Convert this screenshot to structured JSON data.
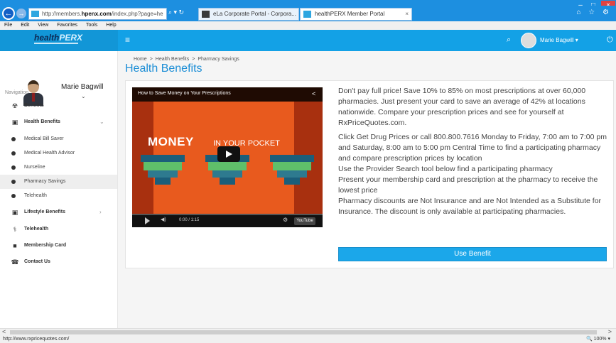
{
  "browser": {
    "url_prefix": "http://members.",
    "url_domain": "hpenx.com",
    "url_suffix": "/index.php?page=he",
    "addr_tools": "⌕ ▾ ↻",
    "tab1_label": "eLa Corporate Portal - Corpora...",
    "tab2_label": "healthPERX Member Portal",
    "tab_close": "×",
    "menu": [
      "File",
      "Edit",
      "View",
      "Favorites",
      "Tools",
      "Help"
    ],
    "status_url": "http://www.rxpricequotes.com/",
    "zoom": "🔍 100% ▾",
    "min_glyph": "–",
    "max_glyph": "□",
    "close_glyph": "×",
    "right_icons": "⌂ ☆ ⚙",
    "back_glyph": "←",
    "fwd_glyph": "→",
    "scroll_left": "<",
    "scroll_right": ">"
  },
  "header": {
    "logo_health": "health",
    "logo_perx": "PERX",
    "hamburger": "≡",
    "search_icon": "⌕",
    "user": "Marie Bagwill ▾",
    "power_icon": "⏻"
  },
  "sidebar": {
    "profile_name": "Marie Bagwill",
    "profile_caret": "⌄",
    "nav_label": "Navigation",
    "items": {
      "benefits": {
        "label": "Benefits",
        "icon": "☢"
      },
      "health_benefits": {
        "label": "Health Benefits",
        "icon": "▣",
        "chev": "⌄"
      },
      "lifestyle_benefits": {
        "label": "Lifestyle Benefits",
        "icon": "▣",
        "chev": "›"
      },
      "telehealth": {
        "label": "Telehealth",
        "icon": "⚕"
      },
      "membership_card": {
        "label": "Membership Card",
        "icon": "■"
      },
      "contact_us": {
        "label": "Contact Us",
        "icon": "☎"
      }
    },
    "sub_items": {
      "medical_bill_saver": "Medical Bill Saver",
      "medical_health_advisor": "Medical Health Advisor",
      "nurseline": "Nurseline",
      "pharmacy_savings": "Pharmacy Savings",
      "telehealth": "Telehealth"
    }
  },
  "main": {
    "breadcrumb": {
      "home": "Home",
      "section": "Health Benefits",
      "page": "Pharmacy Savings",
      "sep": ">"
    },
    "title": "Health Benefits",
    "video": {
      "title": "How to Save Money on Your Prescriptions",
      "share_icon": "<",
      "money": "MONEY",
      "pocket": "IN YOUR POCKET",
      "vol_icon": "◀)",
      "time": "0:00 / 1:15",
      "gear_icon": "⚙",
      "youtube": "YouTube"
    },
    "paragraphs": {
      "p1": "Don't pay full price! Save 10% to 85% on most prescriptions at over 60,000 pharmacies. Just present your card to save an average of 42% at locations nationwide. Compare your prescription prices and see for yourself at RxPriceQuotes.com.",
      "p2": "Click Get Drug Prices or call 800.800.7616 Monday to Friday, 7:00 am to 7:00 pm and Saturday, 8:00 am to 5:00 pm Central Time to find a participating pharmacy and compare prescription prices by location",
      "p3": "Use the Provider Search tool below find a participating pharmacy",
      "p4": "Present your membership card and prescription at the pharmacy to receive the lowest price",
      "p5": "Pharmacy discounts are Not Insurance and are Not Intended as a Substitute for Insurance. The discount is only available at participating pharmacies."
    },
    "use_benefit": "Use Benefit"
  }
}
